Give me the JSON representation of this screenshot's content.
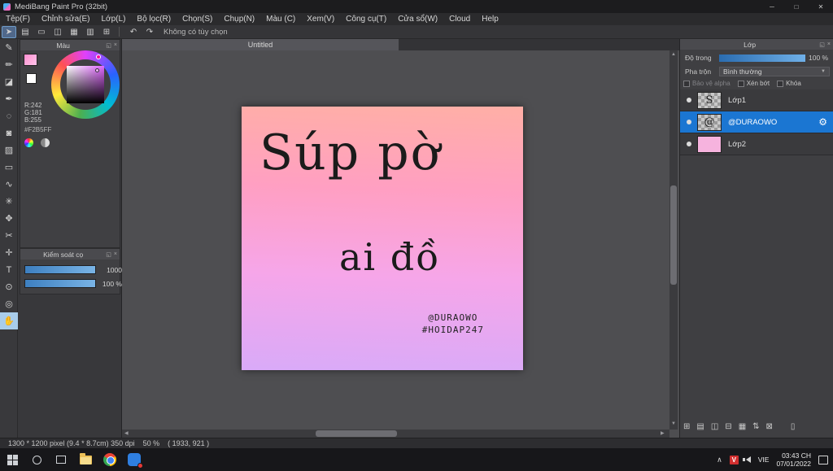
{
  "window": {
    "title": "MediBang Paint Pro (32bit)",
    "controls": {
      "minimize": "─",
      "maximize": "□",
      "close": "✕"
    }
  },
  "menubar": {
    "items": [
      "Tệp(F)",
      "Chỉnh sửa(E)",
      "Lớp(L)",
      "Bộ lọc(R)",
      "Chọn(S)",
      "Chụp(N)",
      "Màu (C)",
      "Xem(V)",
      "Công cụ(T)",
      "Cửa sổ(W)",
      "Cloud",
      "Help"
    ]
  },
  "toolbar": {
    "status_text": "Không có tùy chọn",
    "icons": [
      "➤",
      "▤",
      "▭",
      "◫",
      "▦",
      "▥",
      "⊞"
    ],
    "undo": "↶",
    "redo": "↷"
  },
  "tools": {
    "items": [
      {
        "glyph": "✎"
      },
      {
        "glyph": "✏"
      },
      {
        "glyph": "◪"
      },
      {
        "glyph": "✒"
      },
      {
        "glyph": "◌"
      },
      {
        "glyph": "◙"
      },
      {
        "glyph": "▨"
      },
      {
        "glyph": "▭"
      },
      {
        "glyph": "∿"
      },
      {
        "glyph": "✳"
      },
      {
        "glyph": "✥"
      },
      {
        "glyph": "✂"
      },
      {
        "glyph": "✛"
      },
      {
        "glyph": "T"
      },
      {
        "glyph": "⊙"
      },
      {
        "glyph": "◎"
      },
      {
        "glyph": "✋"
      }
    ]
  },
  "color_panel": {
    "title": "Màu",
    "r_label": "R:242",
    "g_label": "G:181",
    "b_label": "B:255",
    "hex_label": "#F2B5FF",
    "current_color": "#F2B5FF"
  },
  "brush_panel": {
    "title": "Kiểm soát cọ",
    "size_value": "1000",
    "opacity_value": "100 %"
  },
  "canvas": {
    "tab_title": "Untitled",
    "artwork": {
      "line1": "Súp pờ",
      "line2": "ai đồ",
      "credit_line1": "@DURAOWO",
      "credit_line2": "#HOIDAP247"
    }
  },
  "layer_panel": {
    "title": "Lớp",
    "opacity_label": "Độ trong",
    "opacity_value": "100 %",
    "blend_label": "Pha trộn",
    "blend_value": "Bình thường",
    "protect_alpha_label": "Bảo vệ alpha",
    "clipping_label": "Xén bớt",
    "lock_label": "Khóa",
    "layers": [
      {
        "name": "Lớp1",
        "thumb_mark": "S"
      },
      {
        "name": "@DURAOWO",
        "thumb_mark": "@"
      },
      {
        "name": "Lớp2",
        "thumb_mark": ""
      }
    ]
  },
  "statusbar": {
    "doc_info": "1300 * 1200 pixel   (9.4 * 8.7cm)   350 dpi",
    "zoom": "50 %",
    "coords": "( 1933, 921 )"
  },
  "taskbar": {
    "tray_chevron": "∧",
    "unikey_letter": "V",
    "language": "VIE",
    "time": "03:43 CH",
    "date": "07/01/2022"
  },
  "colors": {
    "accent_blue": "#1b76d2",
    "slider_blue": "#4f94d8",
    "current_color": "#F2B5FF"
  }
}
